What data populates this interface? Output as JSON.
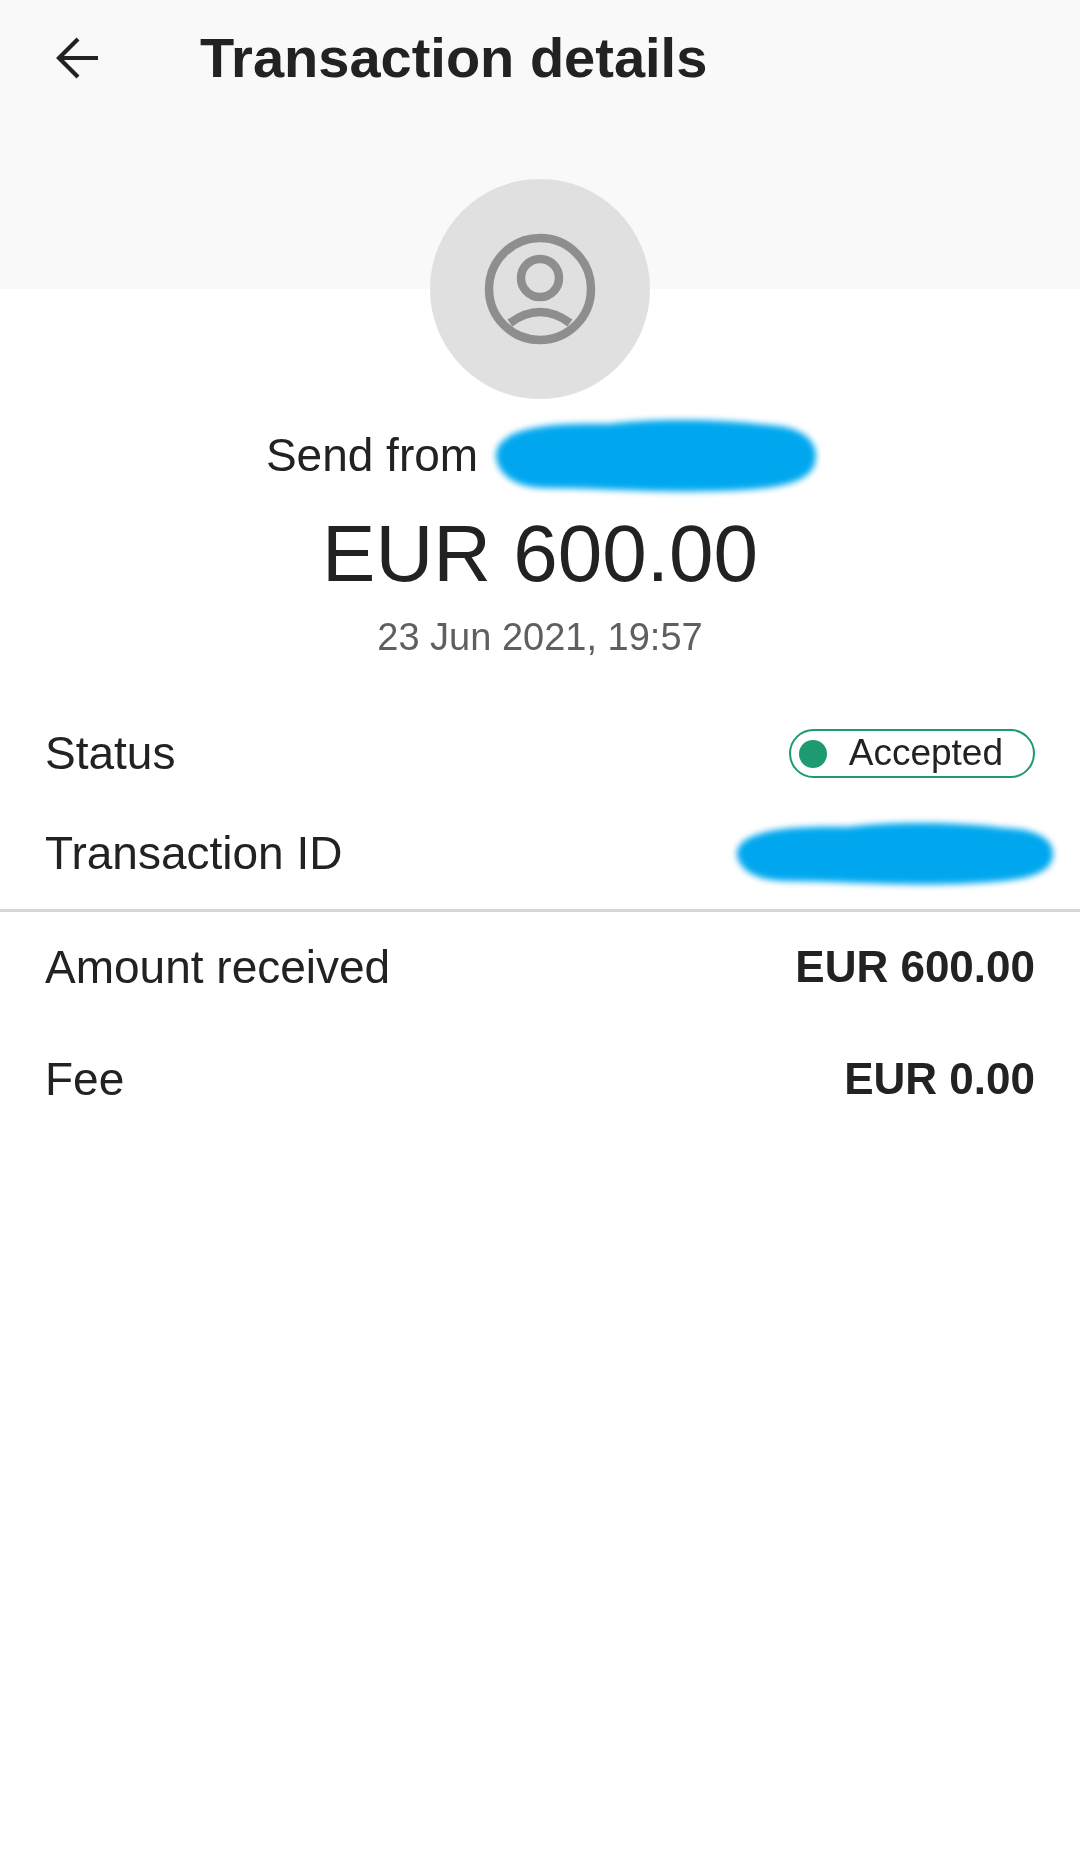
{
  "top_bar": {
    "title": "Transaction details"
  },
  "summary_header": {
    "sender_label": "Send from",
    "sender_redacted": true,
    "amount": "EUR 600.00",
    "date": "23 Jun 2021, 19:57"
  },
  "details": [
    {
      "label": "Status",
      "kind": "status",
      "value": "Accepted",
      "color": "#1e9a73"
    },
    {
      "label": "Transaction ID",
      "kind": "redacted"
    }
  ],
  "amounts": [
    {
      "label": "Amount received",
      "value": "EUR 600.00"
    },
    {
      "label": "Fee",
      "value": "EUR 0.00"
    }
  ]
}
